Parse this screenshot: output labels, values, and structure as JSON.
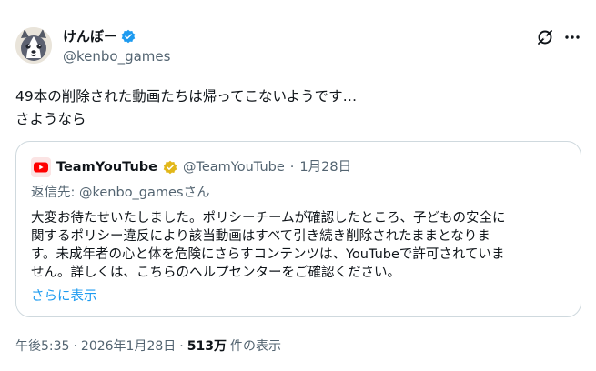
{
  "author": {
    "display_name": "けんぼー",
    "handle": "@kenbo_games",
    "verified_color": "#1d9bf0"
  },
  "tweet": {
    "line1": "49本の削除された動画たちは帰ってこないようです…",
    "line2": "さようなら"
  },
  "quote": {
    "author_name": "TeamYouTube",
    "author_handle": "@TeamYouTube",
    "separator": "·",
    "date": "1月28日",
    "reply_to": "返信先: @kenbo_gamesさん",
    "body_lines": [
      "大変お待たせいたしました。ポリシーチームが確認したところ、子どもの安全に",
      "関するポリシー違反により該当動画はすべて引き続き削除されたままとなりま",
      "す。未成年者の心と体を危険にさらすコンテンツは、YouTubeで許可されていま",
      "せん。詳しくは、こちらのヘルプセンターをご確認ください。"
    ],
    "show_more": "さらに表示",
    "badge_color": "#e2b719",
    "logo_color": "#ff0000"
  },
  "footer": {
    "time": "午後5:35",
    "sep1": "·",
    "date": "2026年1月28日",
    "sep2": "·",
    "views_count": "513万",
    "views_label": "件の表示"
  },
  "colors": {
    "text": "#0f1419",
    "secondary": "#536471",
    "link": "#1d9bf0",
    "border": "#cfd9de"
  }
}
